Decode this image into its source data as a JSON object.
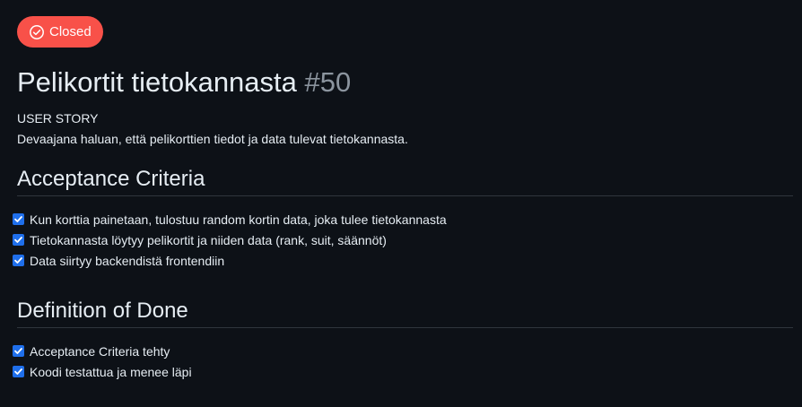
{
  "status": {
    "label": "Closed",
    "icon": "check-circle-icon",
    "color": "#f85149"
  },
  "issue": {
    "title": "Pelikortit tietokannasta",
    "number": "#50"
  },
  "user_story": {
    "heading": "USER STORY",
    "text": "Devaajana haluan, että pelikorttien tiedot ja data tulevat tietokannasta."
  },
  "acceptance_criteria": {
    "title": "Acceptance Criteria",
    "items": [
      {
        "label": "Kun korttia painetaan, tulostuu random kortin data, joka tulee tietokannasta",
        "checked": true
      },
      {
        "label": "Tietokannasta löytyy pelikortit ja niiden data (rank, suit, säännöt)",
        "checked": true
      },
      {
        "label": "Data siirtyy backendistä frontendiin",
        "checked": true
      }
    ]
  },
  "definition_of_done": {
    "title": "Definition of Done",
    "items": [
      {
        "label": "Acceptance Criteria tehty",
        "checked": true
      },
      {
        "label": "Koodi testattua ja menee läpi",
        "checked": true
      }
    ]
  },
  "colors": {
    "background": "#0d1117",
    "text": "#e6edf3",
    "muted": "#8b949e",
    "checkbox": "#1f6feb",
    "divider": "#30363d"
  }
}
